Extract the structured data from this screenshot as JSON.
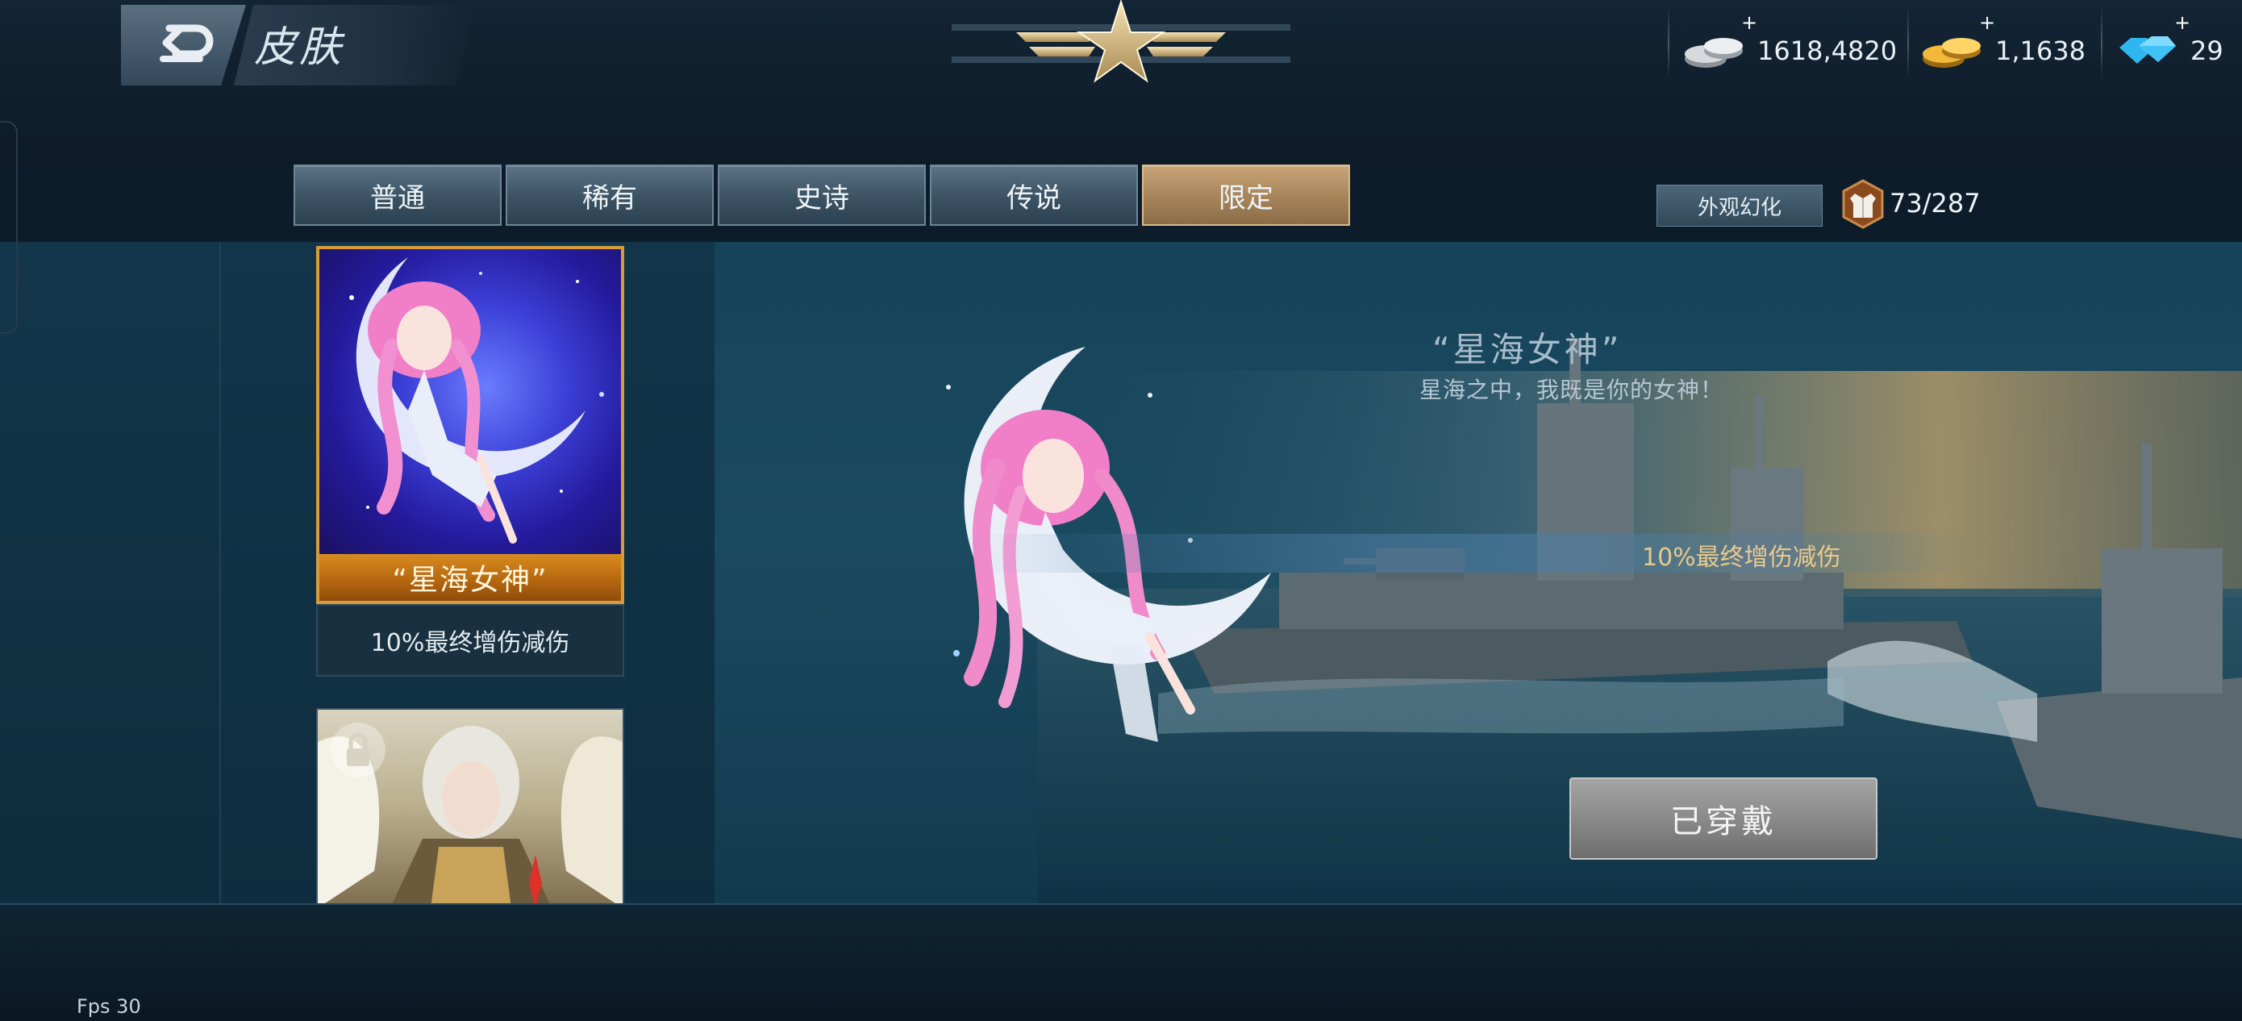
{
  "header": {
    "title": "皮肤",
    "back_icon": "back-arrow-icon",
    "emblem_icon": "star-wings-emblem-icon"
  },
  "resources": [
    {
      "name": "silver",
      "icon": "silver-coins-icon",
      "plus": "+",
      "value": "1618,4820"
    },
    {
      "name": "gold",
      "icon": "gold-coins-icon",
      "plus": "+",
      "value": "1,1638"
    },
    {
      "name": "diamond",
      "icon": "diamond-icon",
      "plus": "+",
      "value": "29"
    }
  ],
  "tabs": [
    {
      "label": "普通",
      "active": false
    },
    {
      "label": "稀有",
      "active": false
    },
    {
      "label": "史诗",
      "active": false
    },
    {
      "label": "传说",
      "active": false
    },
    {
      "label": "限定",
      "active": true
    }
  ],
  "appearance": {
    "button_label": "外观幻化",
    "count_icon": "coat-icon",
    "count": "73/287"
  },
  "skin_list": [
    {
      "name": "“星海女神”",
      "effect": "10%最终增伤减伤",
      "art": "moon-goddess-portrait",
      "selected": true
    },
    {
      "name": "",
      "effect": "",
      "art": "winged-knight-portrait",
      "locked": true,
      "lock_icon": "lock-icon"
    }
  ],
  "detail": {
    "title": "“星海女神”",
    "quote": "星海之中，我既是你的女神！",
    "stat": "10%最终增伤减伤",
    "equipped_label": "已穿戴"
  },
  "footer": {
    "fps": "Fps 30"
  },
  "colors": {
    "active_tab": "#b8956a",
    "tab": "#3f5667",
    "card_border": "#d79b3c",
    "stat_text": "#e8c98c"
  }
}
